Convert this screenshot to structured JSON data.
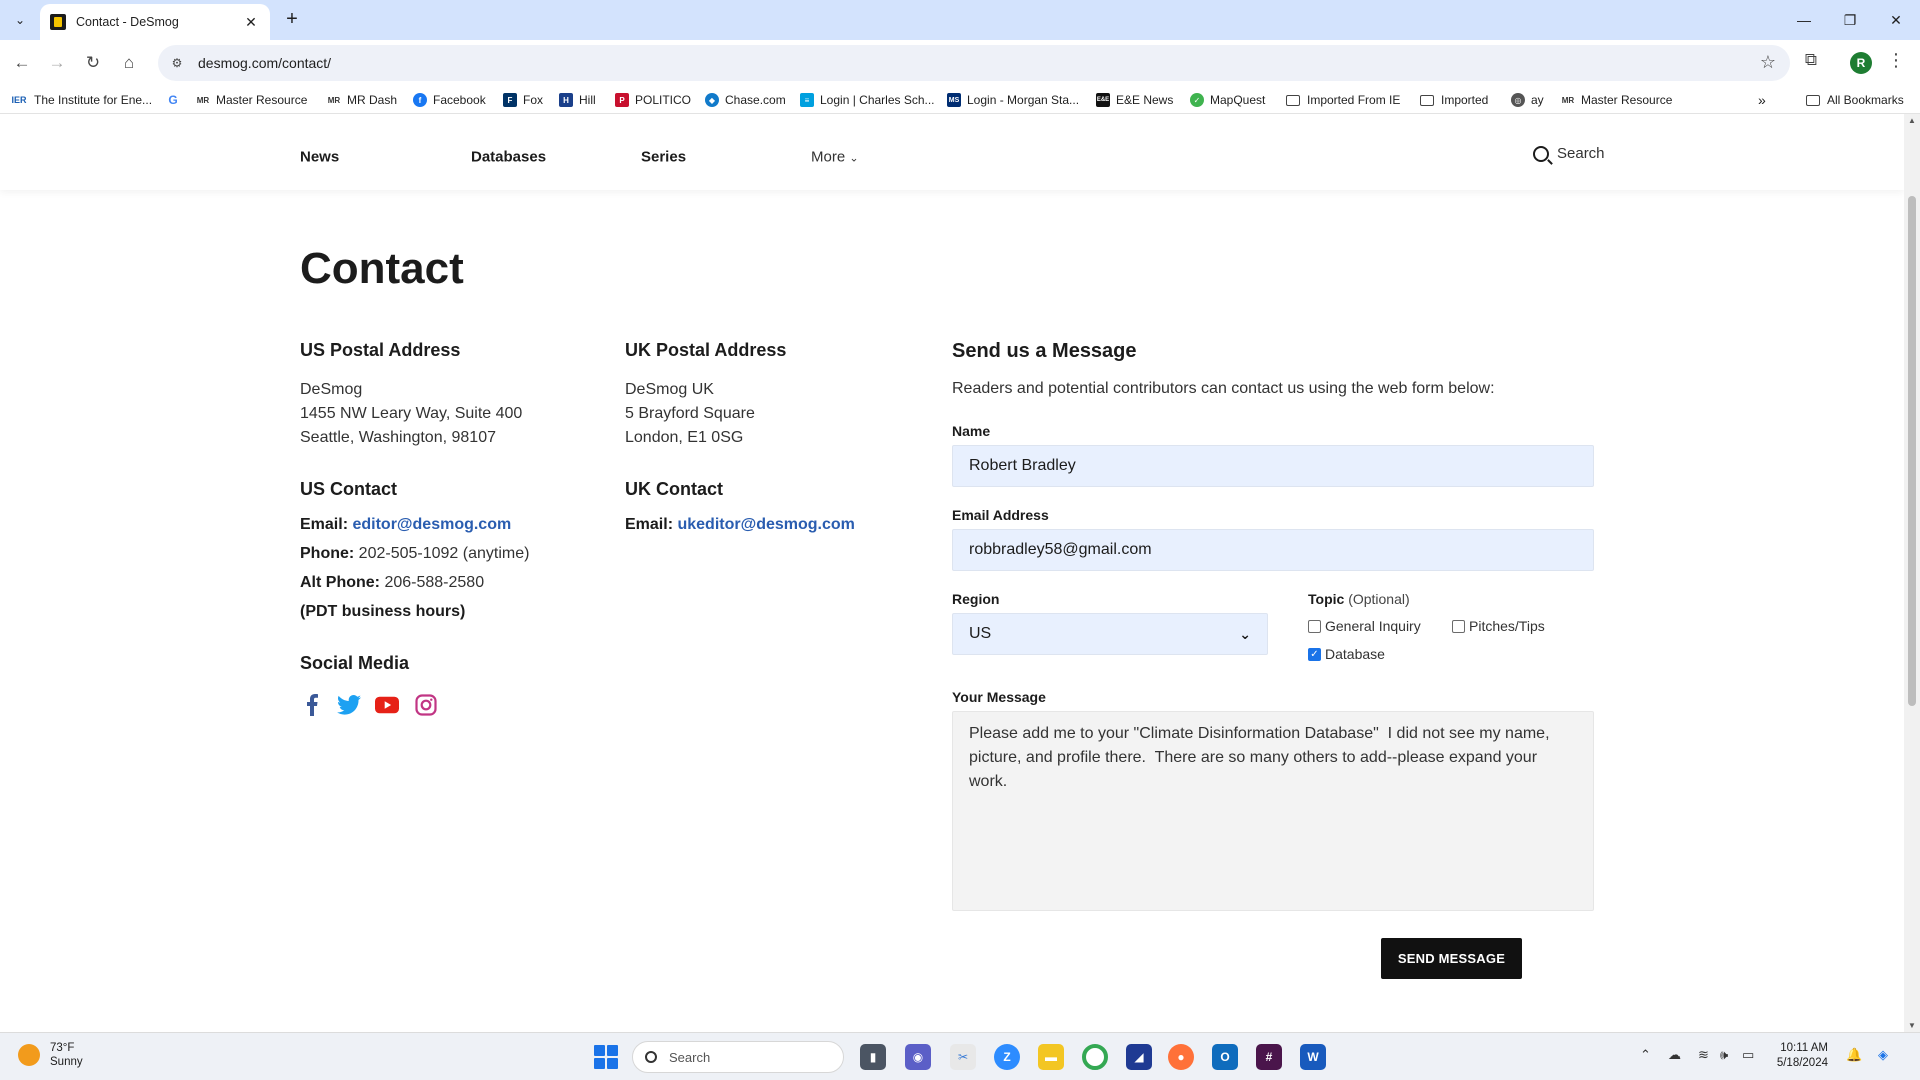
{
  "browser": {
    "tab_title": "Contact - DeSmog",
    "url": "desmog.com/contact/",
    "profile_initial": "R",
    "bookmarks": [
      {
        "label": "The Institute for Ene...",
        "icon": "ier-icon"
      },
      {
        "label": "",
        "icon": "google-icon"
      },
      {
        "label": "Master Resource",
        "icon": "mr-icon"
      },
      {
        "label": "MR Dash",
        "icon": "mr-icon"
      },
      {
        "label": "Facebook",
        "icon": "facebook-icon"
      },
      {
        "label": "Fox",
        "icon": "fox-icon"
      },
      {
        "label": "Hill",
        "icon": "hill-icon"
      },
      {
        "label": "POLITICO",
        "icon": "politico-icon"
      },
      {
        "label": "Chase.com",
        "icon": "chase-icon"
      },
      {
        "label": "Login | Charles Sch...",
        "icon": "schwab-icon"
      },
      {
        "label": "Login - Morgan Sta...",
        "icon": "morgan-stanley-icon"
      },
      {
        "label": "E&E News",
        "icon": "ee-news-icon"
      },
      {
        "label": "MapQuest",
        "icon": "mapquest-icon"
      },
      {
        "label": "Imported From IE",
        "icon": "folder-icon"
      },
      {
        "label": "Imported",
        "icon": "folder-icon"
      },
      {
        "label": "ay",
        "icon": "globe-icon"
      },
      {
        "label": "Master Resource",
        "icon": "mr-icon"
      }
    ],
    "all_bookmarks": "All Bookmarks"
  },
  "site_nav": {
    "items": [
      "News",
      "Databases",
      "Series",
      "More"
    ],
    "search_label": "Search"
  },
  "page": {
    "title": "Contact",
    "us_postal": {
      "heading": "US Postal Address",
      "lines": [
        "DeSmog",
        "1455 NW Leary Way, Suite 400",
        "Seattle, Washington, 98107"
      ]
    },
    "uk_postal": {
      "heading": "UK Postal Address",
      "lines": [
        "DeSmog UK",
        "5 Brayford Square",
        "London, E1 0SG"
      ]
    },
    "us_contact": {
      "heading": "US Contact",
      "email_label": "Email:",
      "email": "editor@desmog.com",
      "phone_label": "Phone:",
      "phone": "202-505-1092 (anytime)",
      "alt_phone_label": "Alt Phone:",
      "alt_phone": "206-588-2580",
      "hours": "(PDT business hours)"
    },
    "uk_contact": {
      "heading": "UK Contact",
      "email_label": "Email:",
      "email": "ukeditor@desmog.com"
    },
    "social": {
      "heading": "Social Media",
      "icons": [
        "facebook-icon",
        "twitter-icon",
        "youtube-icon",
        "instagram-icon"
      ]
    }
  },
  "form": {
    "title": "Send us a Message",
    "intro": "Readers and potential contributors can contact us using the web form below:",
    "name_label": "Name",
    "name_value": "Robert Bradley",
    "email_label": "Email Address",
    "email_value": "robbradley58@gmail.com",
    "region_label": "Region",
    "region_value": "US",
    "topic_label": "Topic",
    "topic_optional": "(Optional)",
    "topics": [
      {
        "label": "General Inquiry",
        "checked": false
      },
      {
        "label": "Pitches/Tips",
        "checked": false
      },
      {
        "label": "Database",
        "checked": true
      }
    ],
    "message_label": "Your Message",
    "message_value": "Please add me to your \"Climate Disinformation Database\"  I did not see my name, picture, and profile there.  There are so many others to add--please expand your work.",
    "submit_label": "SEND MESSAGE"
  },
  "taskbar": {
    "temperature": "73°F",
    "condition": "Sunny",
    "search_label": "Search",
    "time": "10:11 AM",
    "date": "5/18/2024"
  },
  "colors": {
    "accent": "#2a5db0",
    "field_bg": "#e8f0fe",
    "button_bg": "#111111",
    "tab_strip": "#d3e3fd"
  }
}
